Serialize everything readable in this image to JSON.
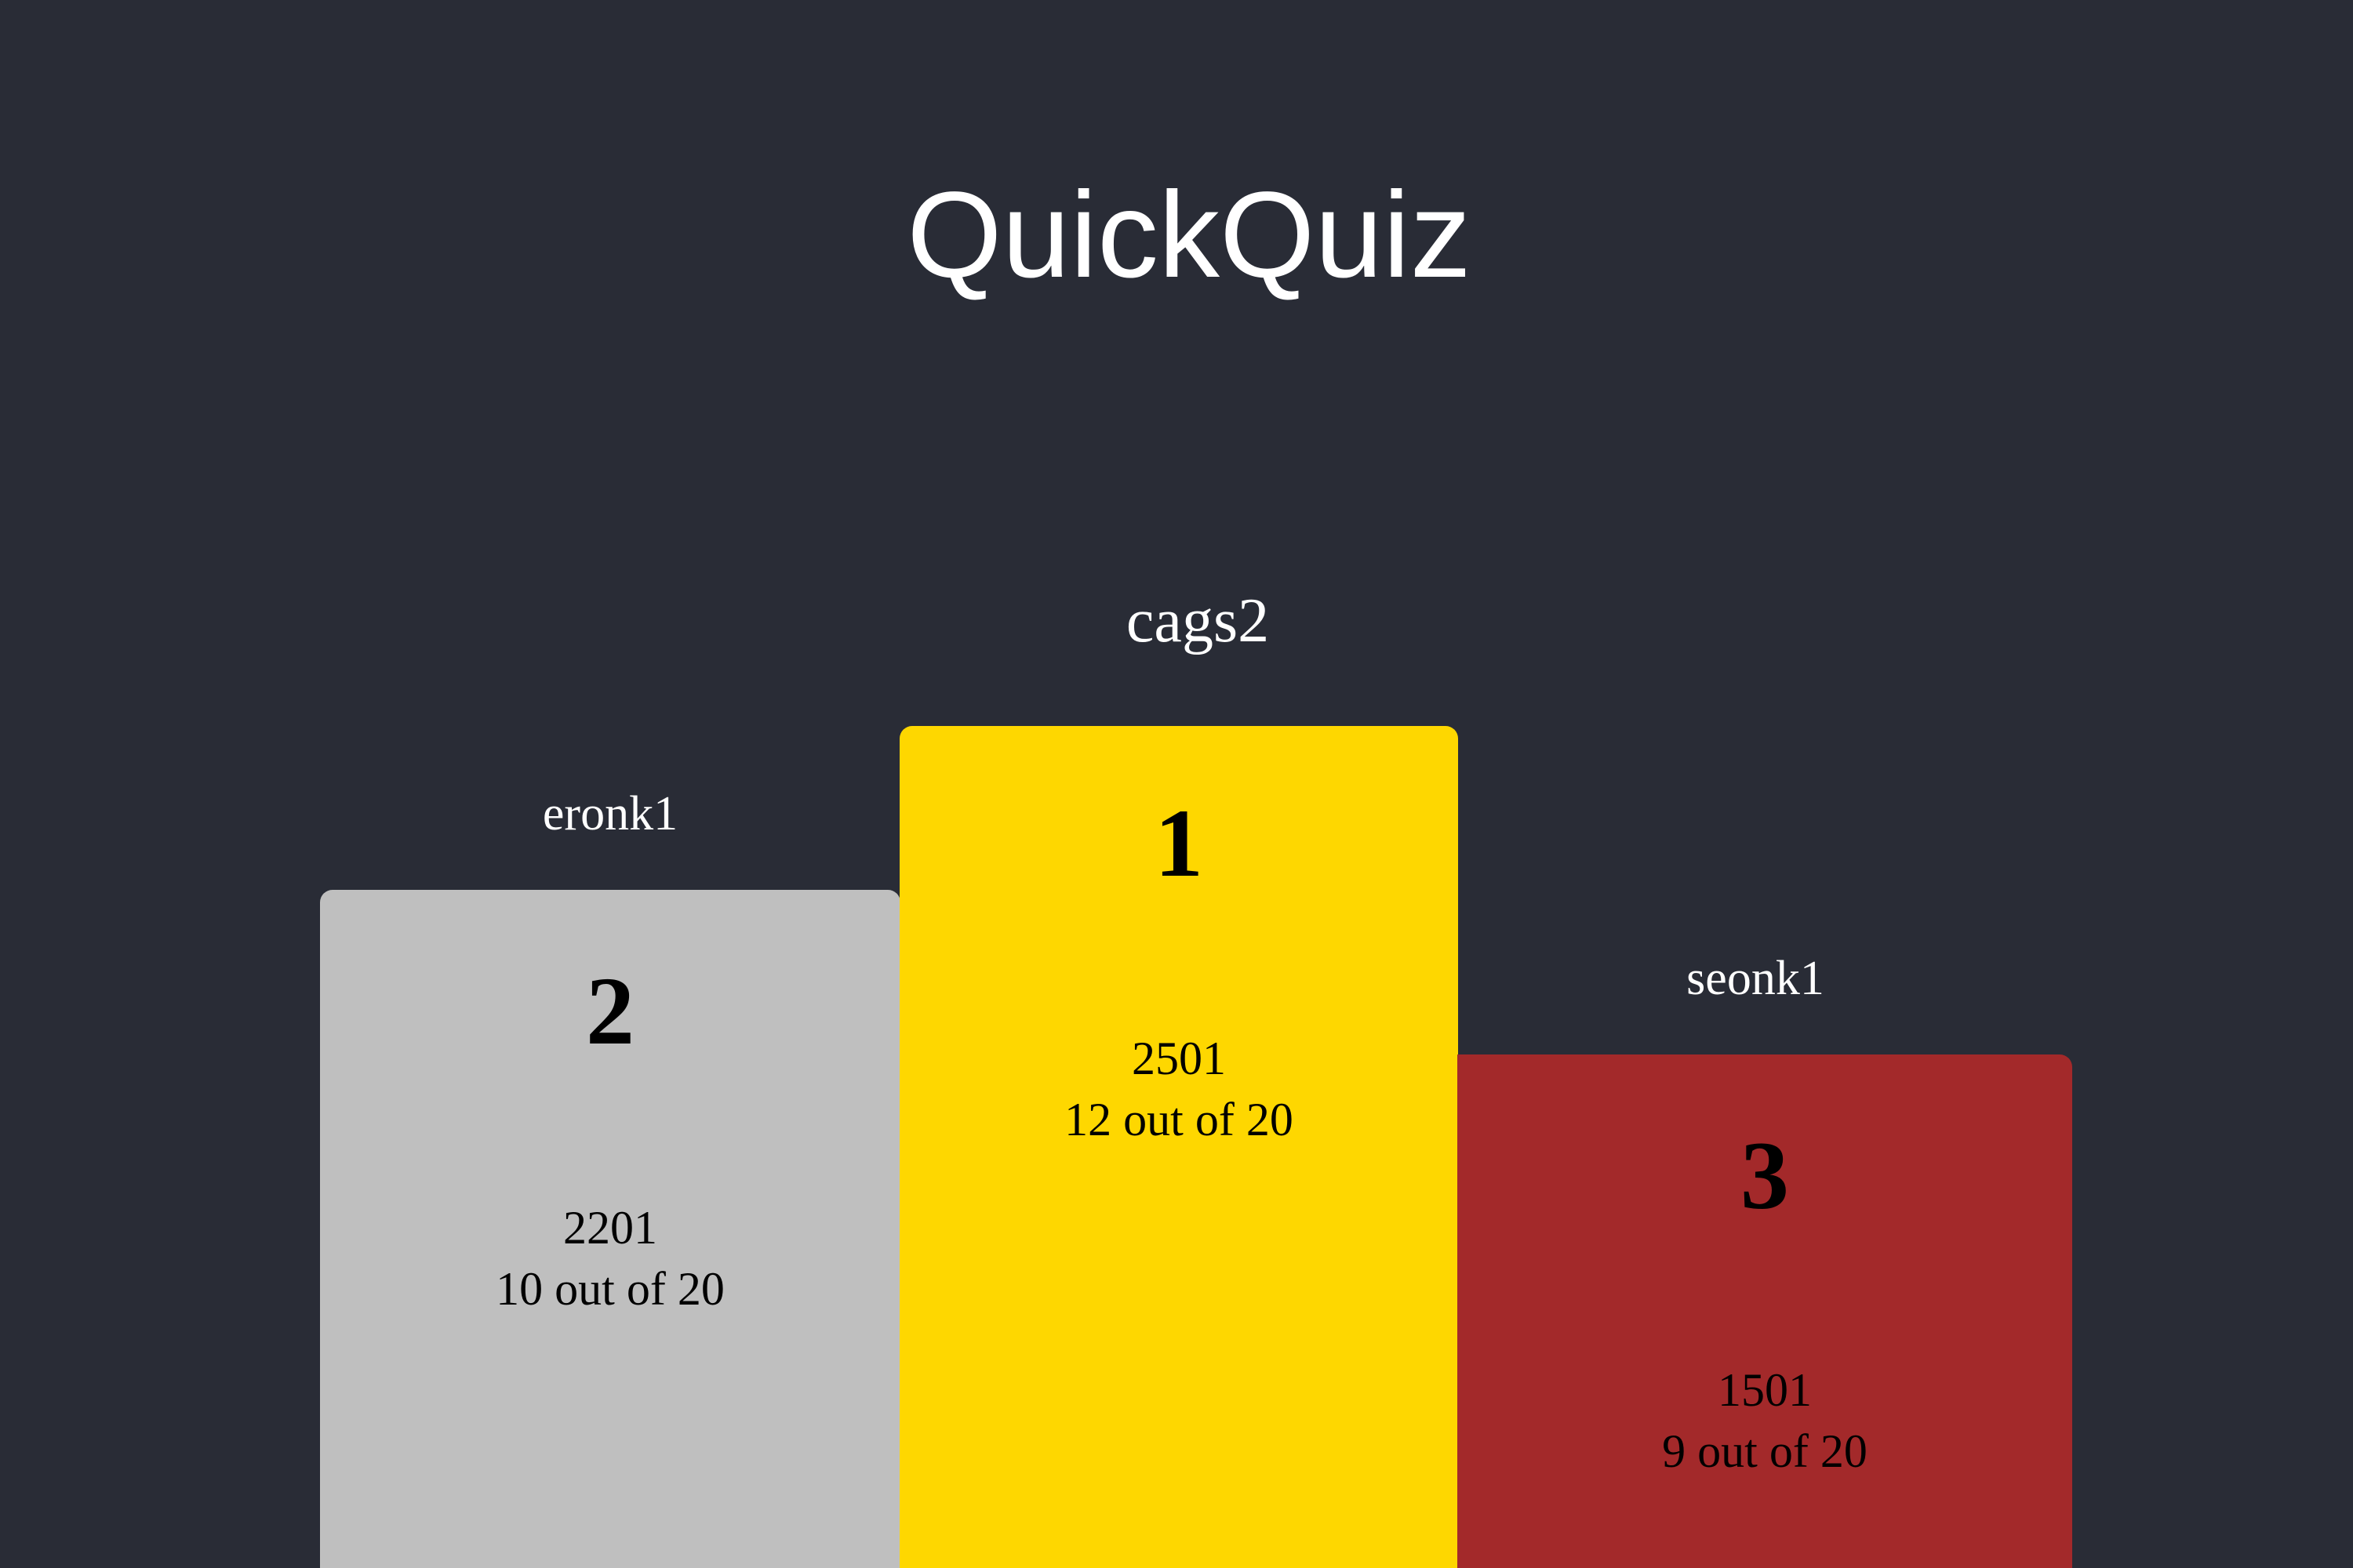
{
  "app": {
    "title": "QuickQuiz"
  },
  "podium": [
    {
      "name": "cags2",
      "rank": "1",
      "score": "2501",
      "correct": "12 out of 20",
      "color": "#fed700"
    },
    {
      "name": "eronk1",
      "rank": "2",
      "score": "2201",
      "correct": "10 out of 20",
      "color": "#bfbfbf"
    },
    {
      "name": "seonk1",
      "rank": "3",
      "score": "1501",
      "correct": "9 out of 20",
      "color": "#a3292a"
    }
  ],
  "theme": {
    "background": "#292c36",
    "text": "#ffffff"
  }
}
